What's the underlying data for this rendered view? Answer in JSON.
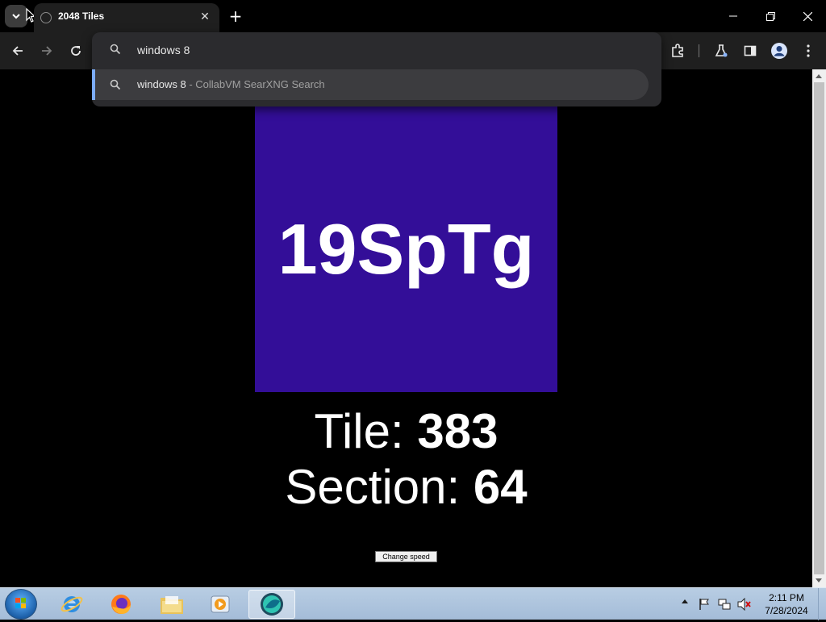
{
  "browser": {
    "tab_title": "2048 Tiles",
    "omnibox_text": "windows 8",
    "suggestion_query": "windows 8",
    "suggestion_source": " - CollabVM SearXNG Search"
  },
  "page": {
    "tile_code": "19SpTg",
    "tile_color": "#330e98",
    "tile_label": "Tile: ",
    "tile_value": "383",
    "section_label": "Section: ",
    "section_value": "64",
    "speed_button": "Change speed"
  },
  "taskbar": {
    "apps": [
      "internet-explorer",
      "firefox",
      "file-explorer",
      "media-player",
      "browser-active"
    ],
    "time": "2:11 PM",
    "date": "7/28/2024"
  }
}
